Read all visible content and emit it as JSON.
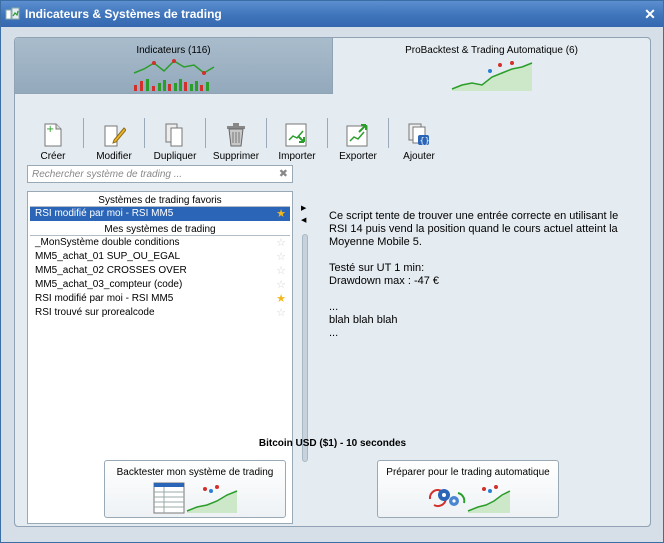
{
  "window": {
    "title": "Indicateurs & Systèmes de trading"
  },
  "tabs": [
    {
      "label": "Indicateurs (116)"
    },
    {
      "label": "ProBacktest & Trading Automatique (6)"
    }
  ],
  "toolbar": [
    {
      "label": "Créer",
      "icon": "new-document-icon"
    },
    {
      "label": "Modifier",
      "icon": "edit-icon"
    },
    {
      "label": "Dupliquer",
      "icon": "duplicate-icon"
    },
    {
      "label": "Supprimer",
      "icon": "trash-icon"
    },
    {
      "label": "Importer",
      "icon": "import-icon"
    },
    {
      "label": "Exporter",
      "icon": "export-icon"
    },
    {
      "label": "Ajouter",
      "icon": "add-icon"
    }
  ],
  "search": {
    "placeholder": "Rechercher système de trading ..."
  },
  "favorites": {
    "header": "Systèmes de trading favoris",
    "items": [
      {
        "label": "RSI modifié par moi - RSI MM5",
        "starred": true
      }
    ]
  },
  "my_systems": {
    "header": "Mes systèmes de trading",
    "items": [
      {
        "label": "_MonSystème double conditions",
        "starred": false
      },
      {
        "label": "MM5_achat_01 SUP_OU_EGAL",
        "starred": false
      },
      {
        "label": "MM5_achat_02 CROSSES OVER",
        "starred": false
      },
      {
        "label": "MM5_achat_03_compteur (code)",
        "starred": false
      },
      {
        "label": "RSI modifié par moi - RSI MM5",
        "starred": true
      },
      {
        "label": "RSI trouvé sur prorealcode",
        "starred": false
      }
    ]
  },
  "description": {
    "line1": "Ce script tente de trouver une entrée correcte en utilisant le RSI 14 puis vend la position quand le cours actuel atteint la Moyenne Mobile 5.",
    "line2": "Testé sur UT 1 min:",
    "line3": "Drawdown max : -47 €",
    "line4": "...",
    "line5": "blah blah blah",
    "line6": "..."
  },
  "instrument": "Bitcoin USD ($1) - 10 secondes",
  "actions": {
    "backtest": "Backtester mon système de trading",
    "automatic": "Préparer pour le trading automatique"
  },
  "colors": {
    "selection": "#2a65b8",
    "titlebar": "#3f74bb",
    "star_on": "#f2b81b"
  }
}
